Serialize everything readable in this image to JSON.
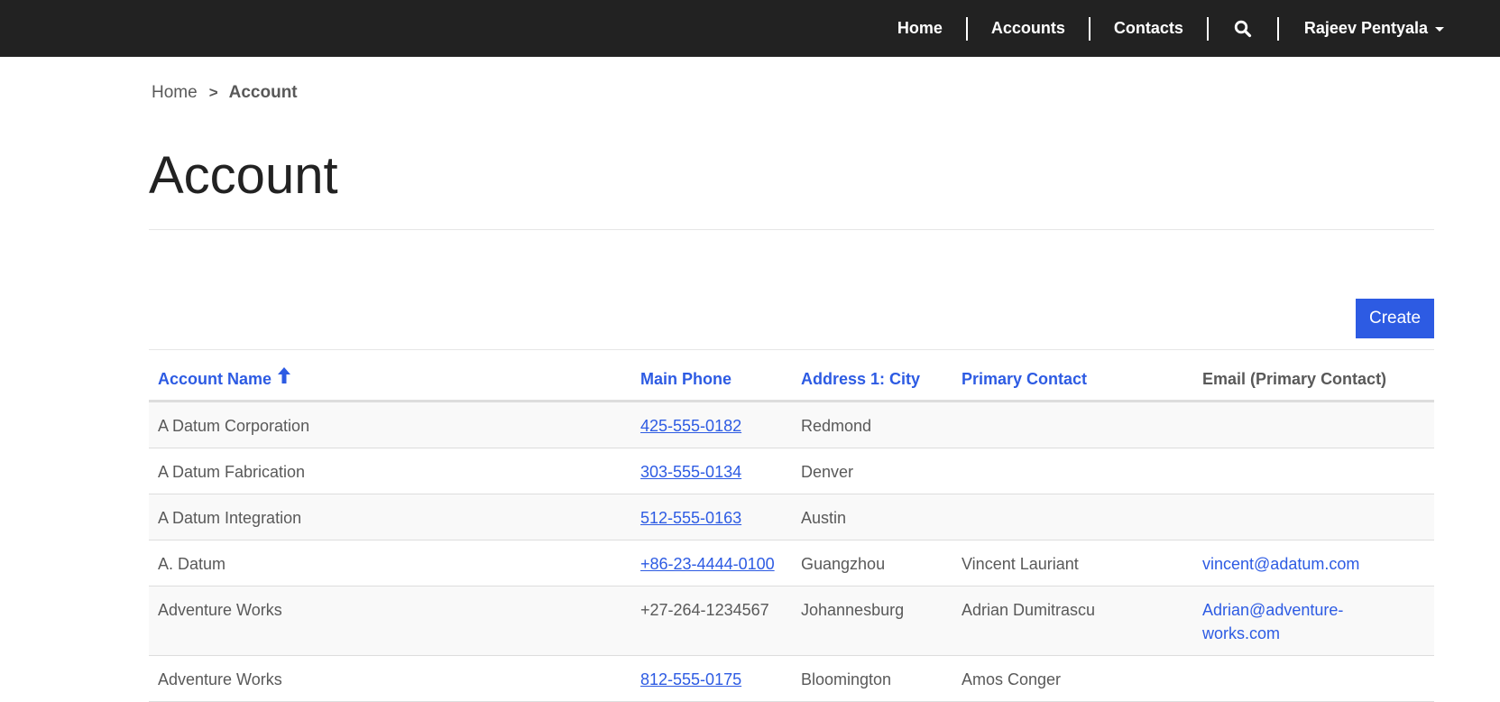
{
  "nav": {
    "items": [
      "Home",
      "Accounts",
      "Contacts"
    ],
    "user": "Rajeev Pentyala"
  },
  "breadcrumb": {
    "home": "Home",
    "separator": ">",
    "current": "Account"
  },
  "page": {
    "title": "Account",
    "create_label": "Create"
  },
  "table": {
    "columns": [
      "Account Name",
      "Main Phone",
      "Address 1: City",
      "Primary Contact",
      "Email (Primary Contact)"
    ],
    "sort_column": "Account Name",
    "sort_direction": "ascending",
    "rows": [
      {
        "name": "A Datum Corporation",
        "phone": "425-555-0182",
        "phone_link": true,
        "city": "Redmond",
        "contact": "",
        "email": ""
      },
      {
        "name": "A Datum Fabrication",
        "phone": "303-555-0134",
        "phone_link": true,
        "city": "Denver",
        "contact": "",
        "email": ""
      },
      {
        "name": "A Datum Integration",
        "phone": "512-555-0163",
        "phone_link": true,
        "city": "Austin",
        "contact": "",
        "email": ""
      },
      {
        "name": "A. Datum",
        "phone": "+86-23-4444-0100",
        "phone_link": true,
        "city": "Guangzhou",
        "contact": "Vincent Lauriant",
        "email": "vincent@adatum.com"
      },
      {
        "name": "Adventure Works",
        "phone": "+27-264-1234567",
        "phone_link": false,
        "city": "Johannesburg",
        "contact": "Adrian Dumitrascu",
        "email": "Adrian@adventure-works.com"
      },
      {
        "name": "Adventure Works",
        "phone": "812-555-0175",
        "phone_link": true,
        "city": "Bloomington",
        "contact": "Amos Conger",
        "email": ""
      }
    ]
  },
  "colors": {
    "navbar": "#222222",
    "accent": "#2d5be3",
    "text": "#595959"
  }
}
